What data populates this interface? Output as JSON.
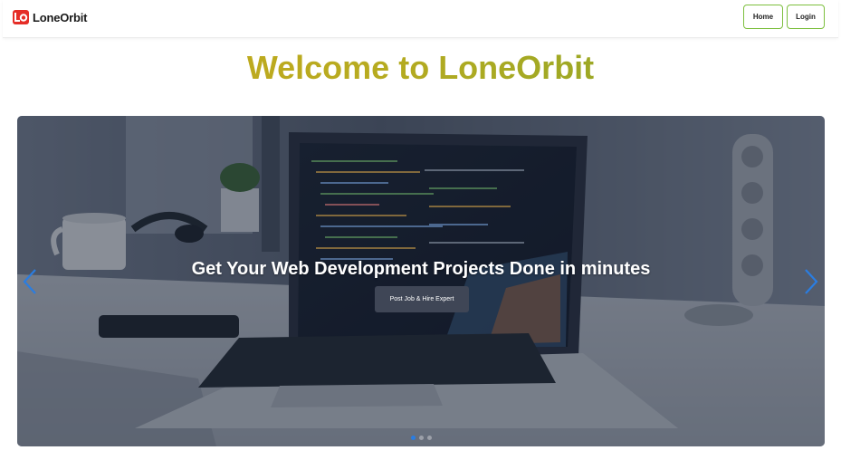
{
  "brand": {
    "name": "LoneOrbit",
    "logo_text": "LO",
    "logo_color": "#e52d27"
  },
  "nav": {
    "home_label": "Home",
    "login_label": "Login",
    "border_color": "#7dbf3e"
  },
  "hero": {
    "title": "Welcome to LoneOrbit",
    "gradient": [
      "#c8a81c",
      "#7fa52a"
    ]
  },
  "carousel": {
    "caption_title": "Get Your Web Development Projects Done in minutes",
    "caption_button": "Post Job & Hire Expert",
    "prev_icon": "chevron-left-icon",
    "next_icon": "chevron-right-icon",
    "arrow_color": "#2a7de1",
    "indicator_count": 3,
    "active_indicator": 1
  }
}
